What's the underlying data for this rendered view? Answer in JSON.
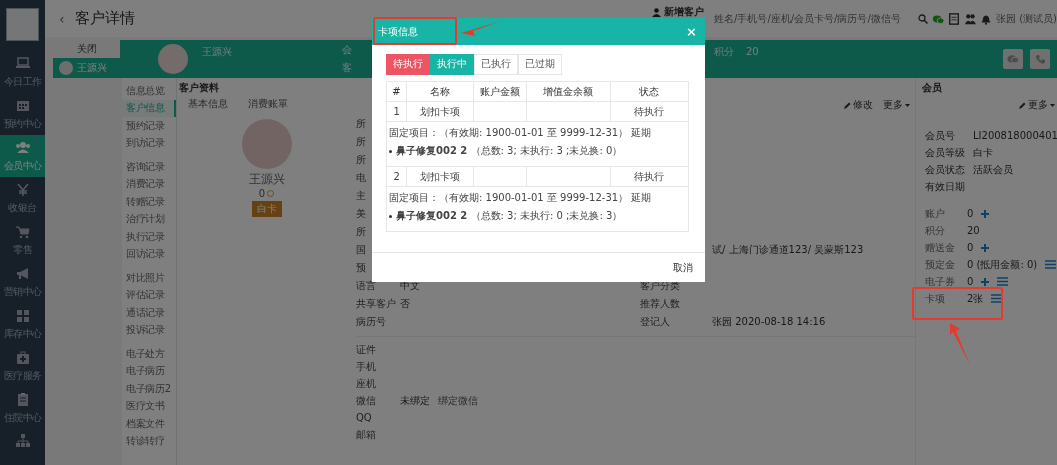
{
  "sidebar": {
    "items": [
      {
        "label": "今日工作",
        "selected": false
      },
      {
        "label": "预约中心",
        "selected": false
      },
      {
        "label": "会员中心",
        "selected": true
      },
      {
        "label": "收银台",
        "selected": false
      },
      {
        "label": "零售",
        "selected": false
      },
      {
        "label": "营销中心",
        "selected": false
      },
      {
        "label": "库存中心",
        "selected": false
      },
      {
        "label": "医疗服务",
        "selected": false
      },
      {
        "label": "住院中心",
        "selected": false
      }
    ]
  },
  "topbar": {
    "back": "‹",
    "title": "客户详情",
    "new_customer": "新增客户",
    "search": {
      "placeholder": "姓名/手机号/座机/会员卡号/病历号/微信号"
    },
    "user": "张园 (测试员)"
  },
  "customer_list": {
    "close": "关闭",
    "customers": [
      {
        "name": "王源兴",
        "selected": true
      }
    ]
  },
  "header": {
    "name": "王源兴",
    "fields": [
      "会",
      "客"
    ],
    "points_label": "积分",
    "points": "20"
  },
  "subnav": {
    "groups": [
      [
        {
          "label": "信息总览",
          "selected": false
        },
        {
          "label": "客户信息",
          "selected": true
        },
        {
          "label": "预约记录",
          "selected": false
        },
        {
          "label": "到访记录",
          "selected": false
        }
      ],
      [
        {
          "label": "咨询记录",
          "selected": false
        },
        {
          "label": "消费记录",
          "selected": false
        },
        {
          "label": "转赠记录",
          "selected": false
        },
        {
          "label": "治疗计划",
          "selected": false
        },
        {
          "label": "执行记录",
          "selected": false
        },
        {
          "label": "回访记录",
          "selected": false
        }
      ],
      [
        {
          "label": "对比照片",
          "selected": false
        },
        {
          "label": "评估记录",
          "selected": false
        },
        {
          "label": "通话记录",
          "selected": false
        },
        {
          "label": "投诉记录",
          "selected": false
        }
      ],
      [
        {
          "label": "电子处方",
          "selected": false
        },
        {
          "label": "电子病历",
          "selected": false
        },
        {
          "label": "电子病历2",
          "selected": false
        },
        {
          "label": "医疗文书",
          "selected": false
        },
        {
          "label": "档案文件",
          "selected": false
        },
        {
          "label": "转诊转疗",
          "selected": false
        }
      ]
    ]
  },
  "profile": {
    "heading": "客户资料",
    "tabs": [
      "基本信息",
      "消费账單"
    ],
    "name": "王源兴",
    "points": "0",
    "badge": "白卡"
  },
  "form": {
    "edit": "修改",
    "more": "更多",
    "sections": [
      [
        {
          "label": "所"
        },
        {
          "label": "所"
        },
        {
          "label": "所"
        },
        {
          "label": "电"
        },
        {
          "label": "主"
        },
        {
          "label": "美"
        },
        {
          "label": "所"
        },
        {
          "label": "国",
          "value2": "试/ 上海门诊通道123/ 吴蒙斯123"
        },
        {
          "label": "预"
        },
        {
          "label": "语言",
          "value": "中文",
          "label2": "客户分类"
        },
        {
          "label": "共享客户",
          "value": "否",
          "label2": "推荐人数"
        },
        {
          "label": "病历号",
          "label2": "登记人",
          "value2": "张园   2020-08-18 14:16"
        }
      ],
      [
        {
          "label": "证件"
        },
        {
          "label": "手机"
        },
        {
          "label": "座机"
        },
        {
          "label": "微信",
          "value": "未绑定",
          "link": "绑定微信"
        },
        {
          "label": "QQ"
        },
        {
          "label": "邮箱"
        }
      ]
    ]
  },
  "member": {
    "heading": "会员",
    "more": "更多",
    "fields": [
      {
        "label": "会员号",
        "value": "LI200818000401"
      },
      {
        "label": "会员等级",
        "value": "白卡"
      },
      {
        "label": "会员状态",
        "value": "活跃会员"
      },
      {
        "label": "有效日期"
      }
    ],
    "accounts": [
      {
        "label": "账户",
        "value": "0",
        "add": true,
        "list": false
      },
      {
        "label": "积分",
        "value": "20",
        "add": false,
        "list": false
      },
      {
        "label": "赠送金",
        "value": "0",
        "add": true,
        "list": false
      },
      {
        "label": "预定金",
        "value": "0 (抵用金额: 0)",
        "add": false,
        "list": true
      },
      {
        "label": "电子券",
        "value": "0",
        "add": true,
        "list": true
      },
      {
        "label": "卡项",
        "value": "2张",
        "add": false,
        "list": true
      }
    ]
  },
  "modal": {
    "title": "卡项信息",
    "close": "×",
    "tabs": [
      {
        "label": "待执行",
        "selected": true,
        "highlighted": false
      },
      {
        "label": "执行中",
        "selected": false,
        "highlighted": true
      },
      {
        "label": "已执行",
        "selected": false,
        "highlighted": false
      },
      {
        "label": "已过期",
        "selected": false,
        "highlighted": false
      }
    ],
    "columns": [
      "#",
      "名称",
      "账户金额",
      "增值金余额",
      "状态"
    ],
    "rows": [
      {
        "index": "1",
        "name": "划扣卡项",
        "status": "待执行",
        "detail": "固定项目：（有效期: 1900-01-01 至 9999-12-31）",
        "detail_link": "延期",
        "items": [
          "**鼻子修复002  2** （总数: 3; 未执行: 3 ;未兑换: 0）"
        ]
      },
      {
        "index": "2",
        "name": "划扣卡项",
        "status": "待执行",
        "detail": "固定项目：（有效期: 1900-01-01 至 9999-12-31）",
        "detail_link": "延期",
        "items": [
          "**鼻子修复002  2** （总数: 3; 未执行: 0 ;未兑换: 3）"
        ]
      }
    ],
    "cancel": "取消"
  }
}
